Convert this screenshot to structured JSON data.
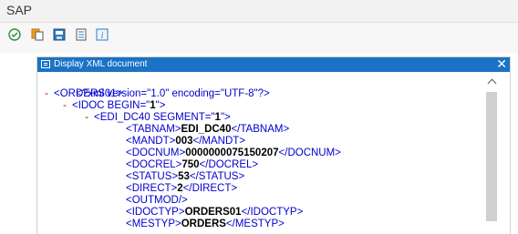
{
  "app": {
    "title": "SAP"
  },
  "toolbar": {
    "icons": [
      "execute-icon",
      "copy-icon",
      "save-icon",
      "print-icon",
      "info-icon"
    ]
  },
  "dialog": {
    "title": "Display XML document",
    "close_label": "✕"
  },
  "xml": {
    "declaration": "<?xml version=\"1.0\" encoding=\"UTF-8\"?>",
    "lines": [
      {
        "indent": 0,
        "toggle": "-",
        "open": "<ORDERS01>",
        "value": "",
        "close": ""
      },
      {
        "indent": 1,
        "toggle": "-",
        "open": "<IDOC BEGIN=\"",
        "value": "1",
        "close": "\">"
      },
      {
        "indent": 2,
        "toggle": "-",
        "open": "<EDI_DC40 SEGMENT=\"",
        "value": "1",
        "close": "\">"
      },
      {
        "indent": 3,
        "toggle": "",
        "open": "<TABNAM>",
        "value": "EDI_DC40",
        "close": "</TABNAM>"
      },
      {
        "indent": 3,
        "toggle": "",
        "open": "<MANDT>",
        "value": "003",
        "close": "</MANDT>"
      },
      {
        "indent": 3,
        "toggle": "",
        "open": "<DOCNUM>",
        "value": "0000000075150207",
        "close": "</DOCNUM>"
      },
      {
        "indent": 3,
        "toggle": "",
        "open": "<DOCREL>",
        "value": "750",
        "close": "</DOCREL>"
      },
      {
        "indent": 3,
        "toggle": "",
        "open": "<STATUS>",
        "value": "53",
        "close": "</STATUS>"
      },
      {
        "indent": 3,
        "toggle": "",
        "open": "<DIRECT>",
        "value": "2",
        "close": "</DIRECT>"
      },
      {
        "indent": 3,
        "toggle": "",
        "open": "<OUTMOD/>",
        "value": "",
        "close": ""
      },
      {
        "indent": 3,
        "toggle": "",
        "open": "<IDOCTYP>",
        "value": "ORDERS01",
        "close": "</IDOCTYP>"
      },
      {
        "indent": 3,
        "toggle": "",
        "open": "<MESTYP>",
        "value": "ORDERS",
        "close": "</MESTYP>"
      }
    ]
  },
  "colors": {
    "accent": "#1a73c6",
    "tag": "#0000cc",
    "toggle": "#c00000"
  }
}
